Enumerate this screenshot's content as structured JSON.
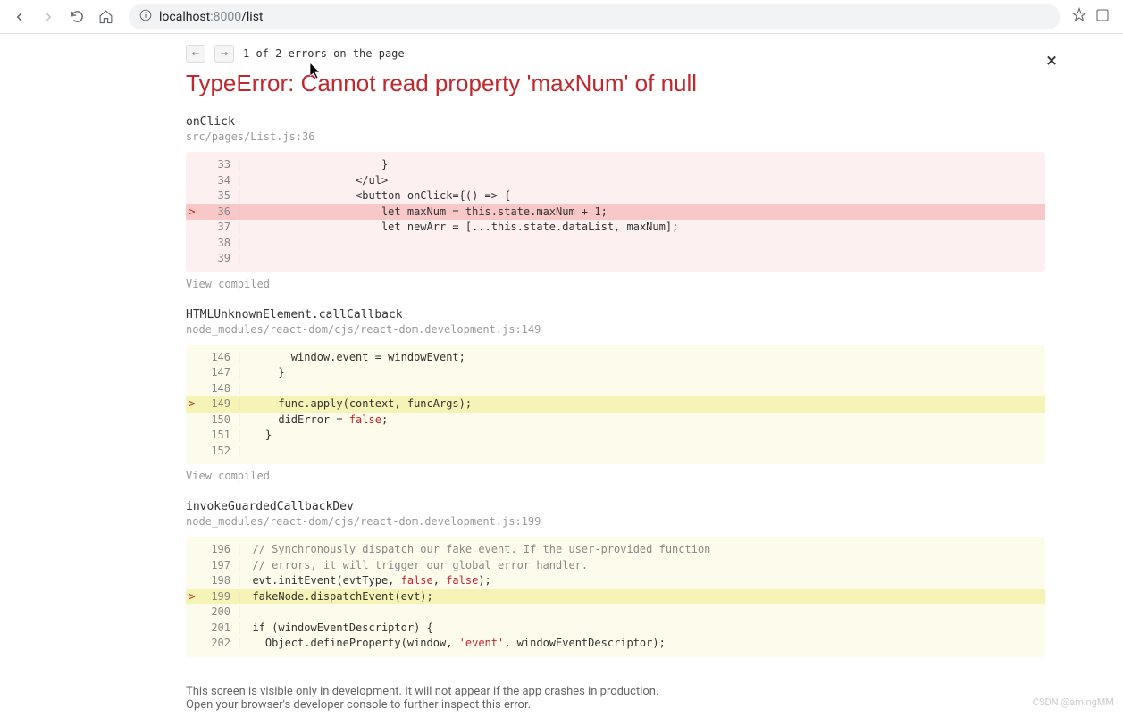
{
  "browser": {
    "url_host": "localhost",
    "url_port": ":8000",
    "url_path": "/list"
  },
  "overlay": {
    "nav_prev": "←",
    "nav_next": "→",
    "error_counter": "1 of 2 errors on the page",
    "title": "TypeError: Cannot read property 'maxNum' of null",
    "close": "×",
    "view_compiled": "View compiled",
    "footer_line1": "This screen is visible only in development. It will not appear if the app crashes in production.",
    "footer_line2": "Open your browser's developer console to further inspect this error."
  },
  "frames": [
    {
      "fn": "onClick",
      "file": "src/pages/List.js:36",
      "theme": "red",
      "lines": [
        {
          "n": "33",
          "m": "",
          "hl": false,
          "segs": [
            {
              "t": "                    }",
              "c": ""
            }
          ]
        },
        {
          "n": "34",
          "m": "",
          "hl": false,
          "segs": [
            {
              "t": "                </ul>",
              "c": ""
            }
          ]
        },
        {
          "n": "35",
          "m": "",
          "hl": false,
          "segs": [
            {
              "t": "                <button onClick={() => {",
              "c": ""
            }
          ]
        },
        {
          "n": "36",
          "m": ">",
          "hl": true,
          "segs": [
            {
              "t": "                    let maxNum = ",
              "c": ""
            },
            {
              "t": "this",
              "c": "tok-kw"
            },
            {
              "t": ".state.maxNum + ",
              "c": ""
            },
            {
              "t": "1",
              "c": "tok-num"
            },
            {
              "t": ";",
              "c": ""
            }
          ]
        },
        {
          "n": "37",
          "m": "",
          "hl": false,
          "segs": [
            {
              "t": "                    let newArr = [...",
              "c": ""
            },
            {
              "t": "this",
              "c": "tok-kw"
            },
            {
              "t": ".state.dataList, maxNum];",
              "c": ""
            }
          ]
        },
        {
          "n": "38",
          "m": "",
          "hl": false,
          "segs": [
            {
              "t": "",
              "c": ""
            }
          ]
        },
        {
          "n": "39",
          "m": "",
          "hl": false,
          "segs": [
            {
              "t": "",
              "c": ""
            }
          ]
        }
      ]
    },
    {
      "fn": "HTMLUnknownElement.callCallback",
      "file": "node_modules/react-dom/cjs/react-dom.development.js:149",
      "theme": "yellow",
      "lines": [
        {
          "n": "146",
          "m": "",
          "hl": false,
          "segs": [
            {
              "t": "      window.event = windowEvent;",
              "c": ""
            }
          ]
        },
        {
          "n": "147",
          "m": "",
          "hl": false,
          "segs": [
            {
              "t": "    }",
              "c": ""
            }
          ]
        },
        {
          "n": "148",
          "m": "",
          "hl": false,
          "segs": [
            {
              "t": "",
              "c": ""
            }
          ]
        },
        {
          "n": "149",
          "m": ">",
          "hl": true,
          "segs": [
            {
              "t": "    func.apply(context, funcArgs);",
              "c": ""
            }
          ]
        },
        {
          "n": "150",
          "m": "",
          "hl": false,
          "segs": [
            {
              "t": "    didError = ",
              "c": ""
            },
            {
              "t": "false",
              "c": "tok-bool"
            },
            {
              "t": ";",
              "c": ""
            }
          ]
        },
        {
          "n": "151",
          "m": "",
          "hl": false,
          "segs": [
            {
              "t": "  }",
              "c": ""
            }
          ]
        },
        {
          "n": "152",
          "m": "",
          "hl": false,
          "segs": [
            {
              "t": "",
              "c": ""
            }
          ]
        }
      ]
    },
    {
      "fn": "invokeGuardedCallbackDev",
      "file": "node_modules/react-dom/cjs/react-dom.development.js:199",
      "theme": "yellow",
      "lines": [
        {
          "n": "196",
          "m": "",
          "hl": false,
          "segs": [
            {
              "t": "// Synchronously dispatch our fake event. If the user-provided function",
              "c": "tok-comment"
            }
          ]
        },
        {
          "n": "197",
          "m": "",
          "hl": false,
          "segs": [
            {
              "t": "// errors, it will trigger our global error handler.",
              "c": "tok-comment"
            }
          ]
        },
        {
          "n": "198",
          "m": "",
          "hl": false,
          "segs": [
            {
              "t": "evt.initEvent(evtType, ",
              "c": ""
            },
            {
              "t": "false",
              "c": "tok-bool"
            },
            {
              "t": ", ",
              "c": ""
            },
            {
              "t": "false",
              "c": "tok-bool"
            },
            {
              "t": ");",
              "c": ""
            }
          ]
        },
        {
          "n": "199",
          "m": ">",
          "hl": true,
          "segs": [
            {
              "t": "fakeNode.dispatchEvent(evt);",
              "c": ""
            }
          ]
        },
        {
          "n": "200",
          "m": "",
          "hl": false,
          "segs": [
            {
              "t": "",
              "c": ""
            }
          ]
        },
        {
          "n": "201",
          "m": "",
          "hl": false,
          "segs": [
            {
              "t": "if",
              "c": "tok-kw"
            },
            {
              "t": " (windowEventDescriptor) {",
              "c": ""
            }
          ]
        },
        {
          "n": "202",
          "m": "",
          "hl": false,
          "segs": [
            {
              "t": "  Object.defineProperty(window, ",
              "c": ""
            },
            {
              "t": "'event'",
              "c": "tok-str"
            },
            {
              "t": ", windowEventDescriptor);",
              "c": ""
            }
          ]
        }
      ]
    }
  ],
  "watermark": "CSDN @amingMM"
}
